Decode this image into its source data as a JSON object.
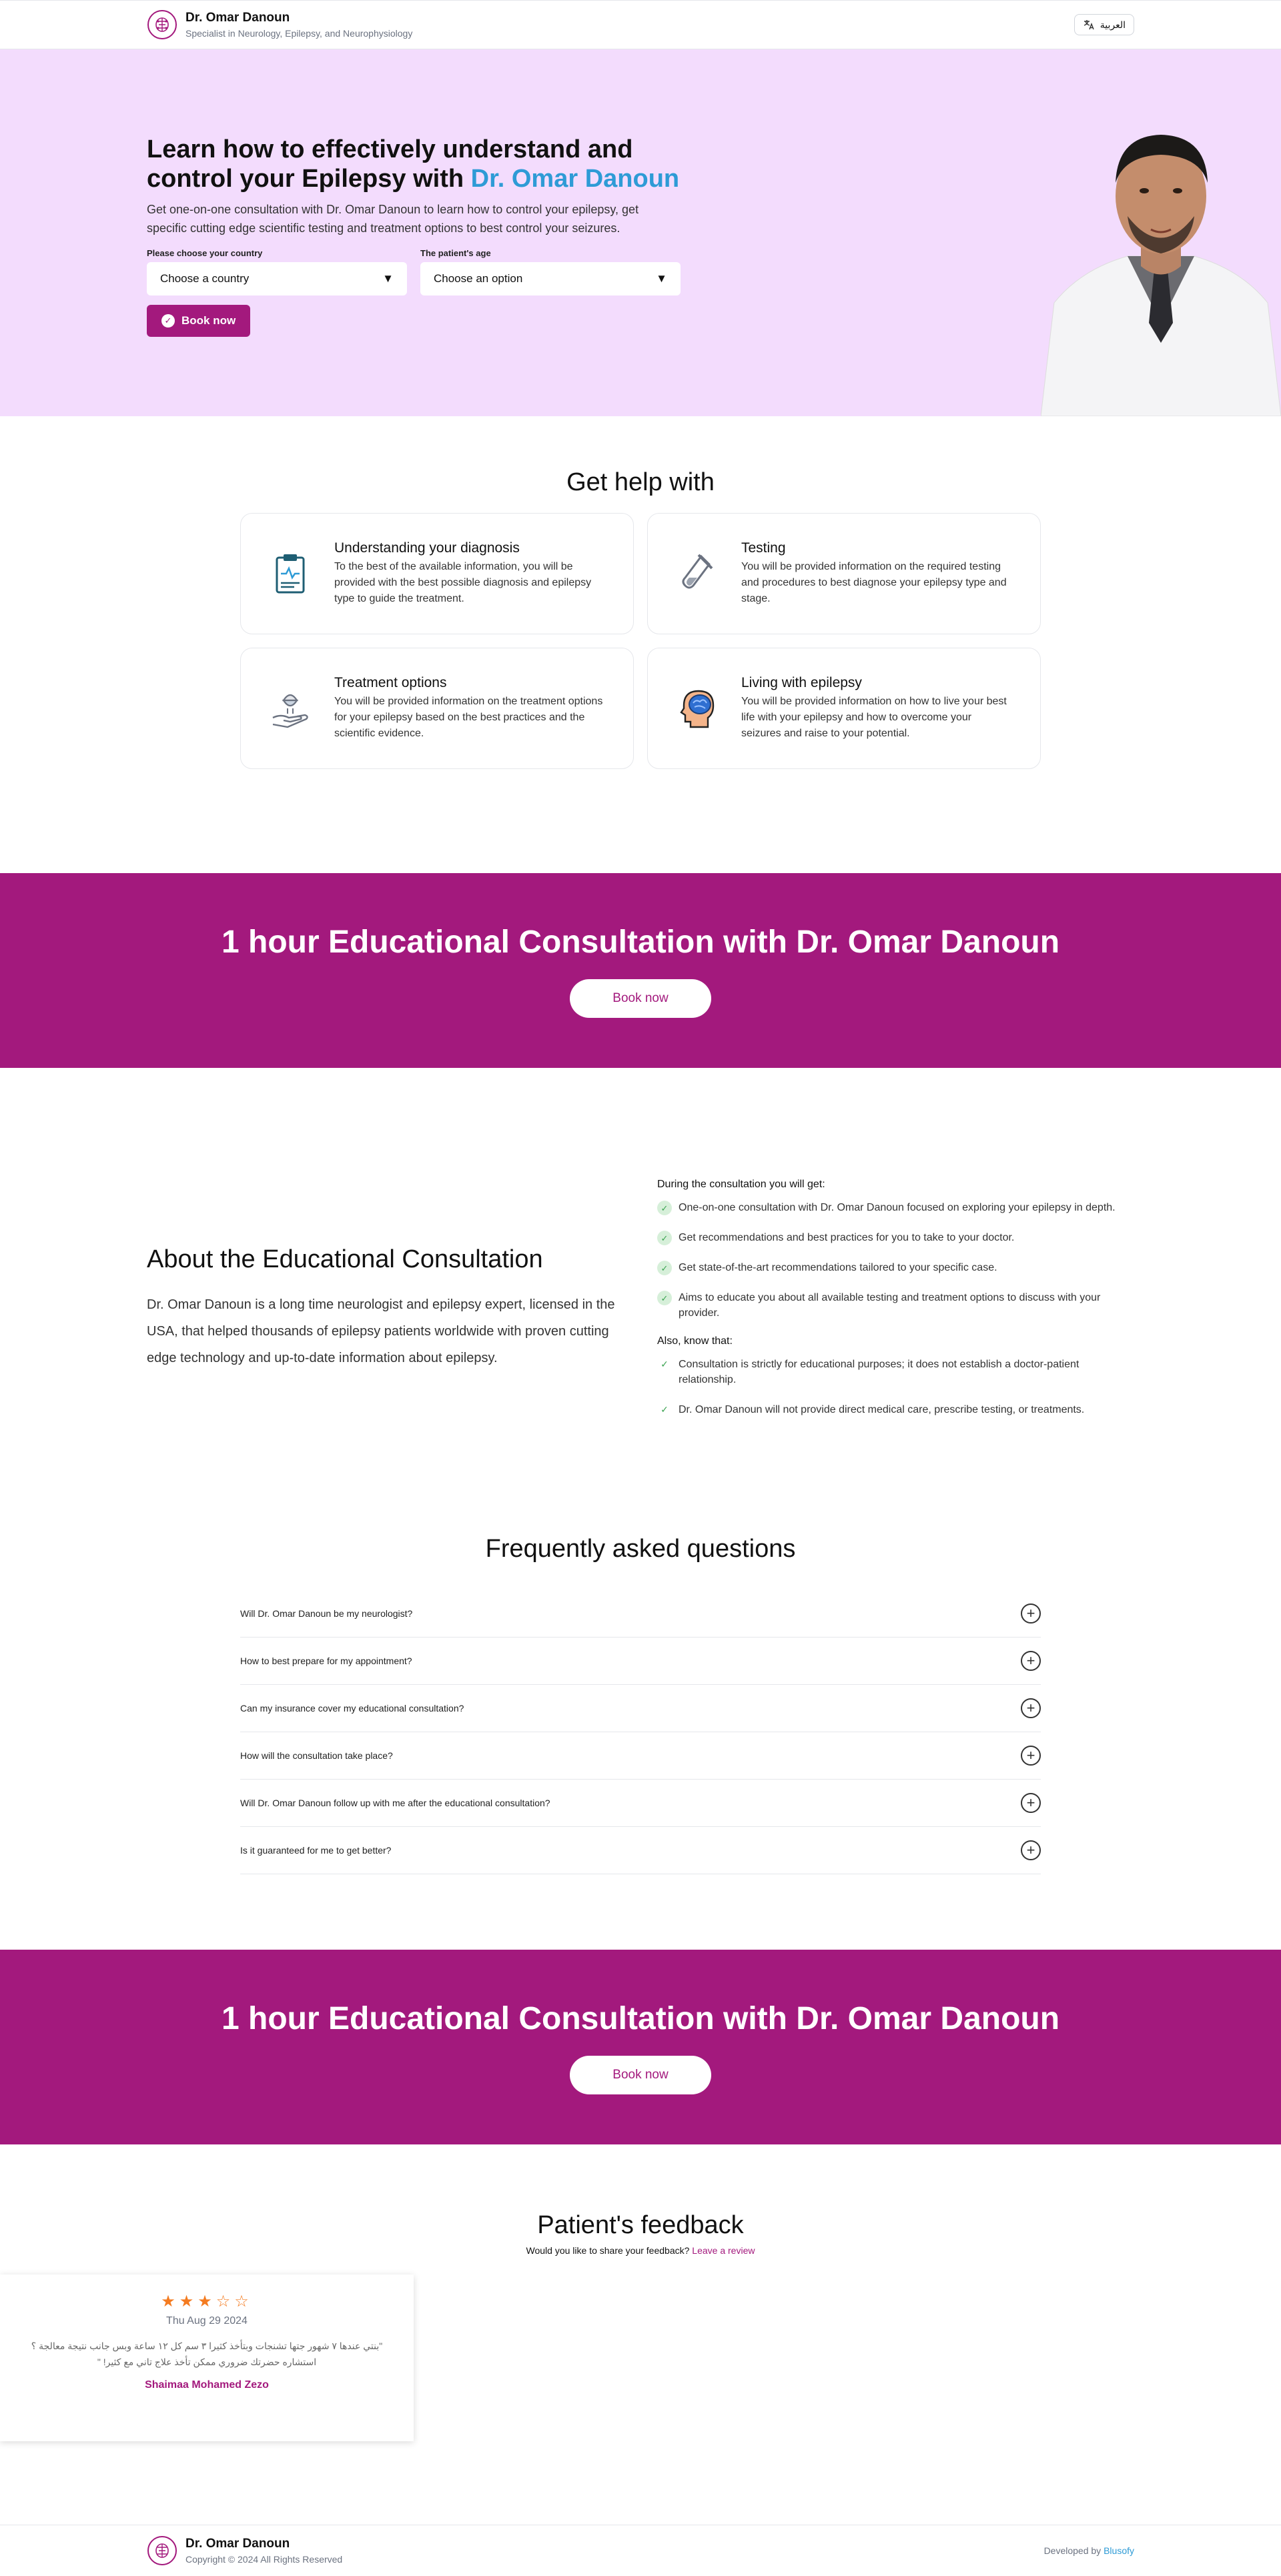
{
  "header": {
    "name": "Dr. Omar Danoun",
    "subtitle": "Specialist in Neurology, Epilepsy, and Neurophysiology",
    "lang_button": "العربية"
  },
  "hero": {
    "title_part1": "Learn how to effectively understand and control your Epilepsy with ",
    "title_accent": "Dr. Omar Danoun",
    "lead": "Get one-on-one consultation with Dr. Omar Danoun to learn how to control your epilepsy, get specific cutting edge scientific testing and treatment options to best control your seizures.",
    "country_label": "Please choose your country",
    "country_value": "Choose a country",
    "age_label": "The patient's age",
    "age_value": "Choose an option",
    "book_label": "Book now"
  },
  "help": {
    "title": "Get help with",
    "cards": [
      {
        "title": "Understanding your diagnosis",
        "text": "To the best of the available information, you will be provided with the best possible diagnosis and epilepsy type to guide the treatment.",
        "icon": "clipboard-icon"
      },
      {
        "title": "Testing",
        "text": "You will be provided information on the required testing and procedures to best diagnose your epilepsy type and stage.",
        "icon": "test-tube-icon"
      },
      {
        "title": "Treatment options",
        "text": "You will be provided information on the treatment options for your epilepsy based on the best practices and the scientific evidence.",
        "icon": "hand-capsule-icon"
      },
      {
        "title": "Living with epilepsy",
        "text": "You will be provided information on how to live your best life with your epilepsy and how to overcome your seizures and raise to your potential.",
        "icon": "brain-head-icon"
      }
    ]
  },
  "cta": {
    "title": "1 hour Educational Consultation with Dr. Omar Danoun",
    "button": "Book now"
  },
  "about": {
    "title": "About the Educational Consultation",
    "text": "Dr. Omar Danoun is a long time neurologist and epilepsy expert, licensed in the USA, that helped thousands of epilepsy patients worldwide with proven cutting edge technology and up-to-date information about epilepsy.",
    "get_heading": "During the consultation you will get:",
    "get_items": [
      "One-on-one consultation with Dr. Omar Danoun focused on exploring your epilepsy in depth.",
      "Get recommendations and best practices for you to take to your doctor.",
      "Get state-of-the-art recommendations tailored to your specific case.",
      "Aims to educate you about all available testing and treatment options to discuss with your provider."
    ],
    "also_heading": "Also, know that:",
    "also_items": [
      "Consultation is strictly for educational purposes; it does not establish a doctor-patient relationship.",
      "Dr. Omar Danoun will not provide direct medical care, prescribe testing, or treatments."
    ]
  },
  "faq": {
    "title": "Frequently asked questions",
    "items": [
      "Will Dr. Omar Danoun be my neurologist?",
      "How to best prepare for my appointment?",
      "Can my insurance cover my educational consultation?",
      "How will the consultation take place?",
      "Will Dr. Omar Danoun follow up with me after the educational consultation?",
      "Is it guaranteed for me to get better?"
    ]
  },
  "cta2": {
    "title": "1 hour Educational Consultation with Dr. Omar Danoun",
    "button": "Book now"
  },
  "feedback": {
    "title": "Patient's feedback",
    "prompt": "Would you like to share your feedback?",
    "link": "Leave a review",
    "review": {
      "rating": 3,
      "max_rating": 5,
      "date": "Thu Aug 29 2024",
      "text": "\"بنتي عندها ٧ شهور جتها تشنجات وبتأخذ كثيرا ٣ سم كل ١٢ ساعة وبس جانب نتيجة معالجة ؟ استشاره حضرتك ضروري ممكن تأخذ علاج تاني مع كثير! \"",
      "author": "Shaimaa Mohamed Zezo"
    }
  },
  "footer": {
    "name": "Dr. Omar Danoun",
    "copyright": "Copyright © 2024 All Rights Reserved",
    "dev_prefix": "Developed by",
    "dev_name": "Blusofy"
  },
  "colors": {
    "brand": "#a3197d",
    "accent": "#2e9bd6",
    "hero_bg": "#f3dcfd",
    "star": "#f47b20"
  }
}
